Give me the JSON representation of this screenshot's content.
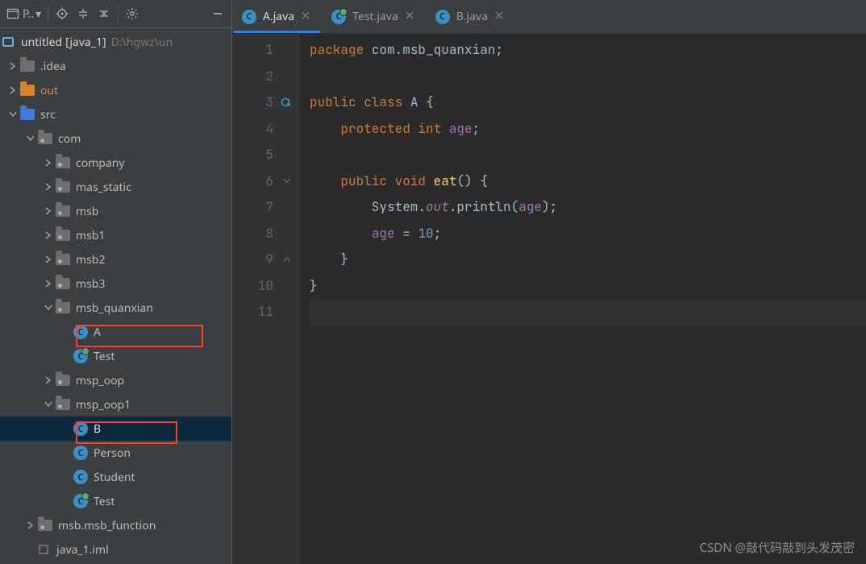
{
  "toolbar": {
    "project_label": "P..",
    "project_dropdown": "▾"
  },
  "project": {
    "root_name": "untitled",
    "root_qualifier": "[java_1]",
    "root_path": "D:\\hgwz\\un"
  },
  "tree": {
    "idea": ".idea",
    "out": "out",
    "src": "src",
    "com": "com",
    "company": "company",
    "mas_static": "mas_static",
    "msb": "msb",
    "msb1": "msb1",
    "msb2": "msb2",
    "msb3": "msb3",
    "msb_quanxian": "msb_quanxian",
    "A": "A",
    "Test1": "Test",
    "msp_oop": "msp_oop",
    "msp_oop1": "msp_oop1",
    "B": "B",
    "Person": "Person",
    "Student": "Student",
    "Test2": "Test",
    "msb_function": "msb.msb_function",
    "iml": "java_1.iml"
  },
  "tabs": {
    "a": "A.java",
    "test": "Test.java",
    "b": "B.java"
  },
  "gutter": [
    "1",
    "2",
    "3",
    "4",
    "5",
    "6",
    "7",
    "8",
    "9",
    "10",
    "11"
  ],
  "code": {
    "l1a": "package ",
    "l1b": "com.msb_quanxian",
    "l1c": ";",
    "l3a": "public ",
    "l3b": "class ",
    "l3c": "A ",
    "l3d": "{",
    "l4a": "    ",
    "l4b": "protected ",
    "l4c": "int ",
    "l4d": "age",
    "l4e": ";",
    "l6a": "    ",
    "l6b": "public ",
    "l6c": "void ",
    "l6d": "eat",
    "l6e": "() {",
    "l7a": "        System.",
    "l7b": "out",
    "l7c": ".println(",
    "l7d": "age",
    "l7e": ");",
    "l8a": "        ",
    "l8b": "age",
    "l8c": " = ",
    "l8d": "10",
    "l8e": ";",
    "l9": "    }",
    "l10": "}"
  },
  "watermark": "CSDN @敲代码敲到头发茂密"
}
